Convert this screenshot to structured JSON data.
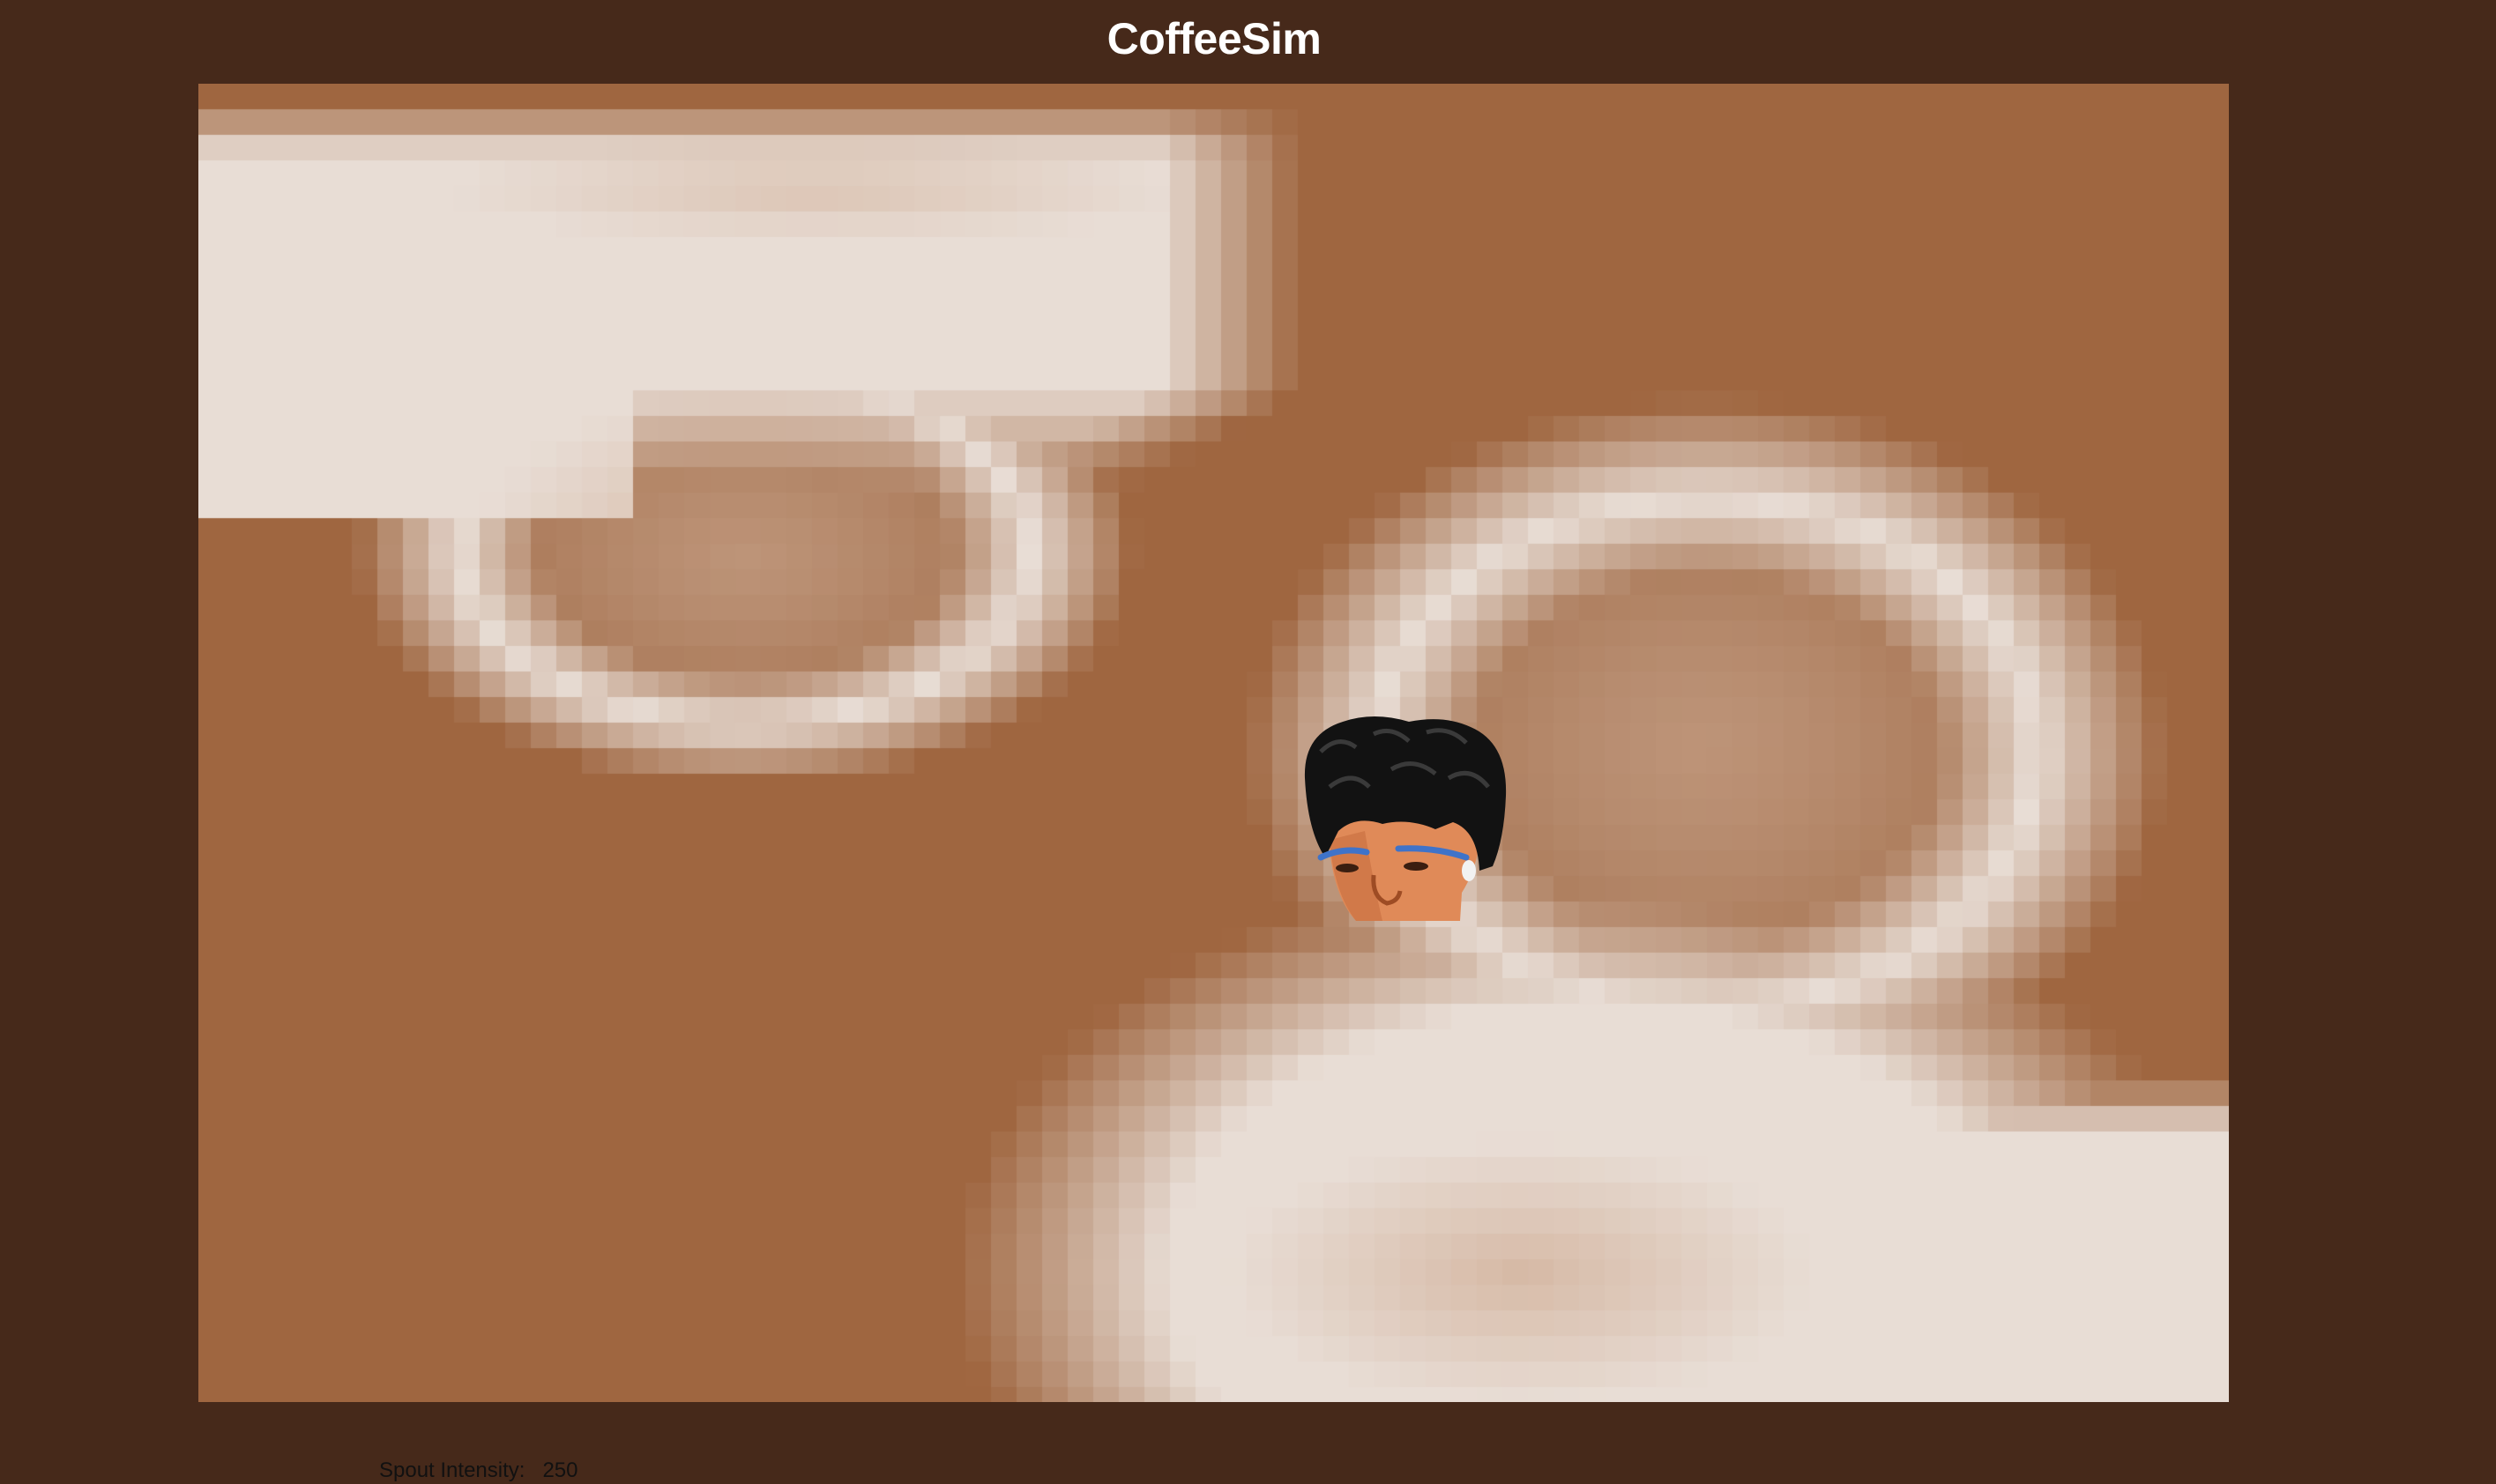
{
  "app": {
    "title": "CoffeeSim"
  },
  "controls": {
    "spout_intensity_label": "Spout Intensity:",
    "spout_intensity_value": "250"
  },
  "colors": {
    "page_background": "#46291a",
    "coffee": "#9f6640",
    "foam_light": "#e8ddd5",
    "foam_mid": "#d6b9a5",
    "title_text": "#ffffff"
  },
  "icons": {
    "player_avatar": "face-avatar-icon"
  }
}
